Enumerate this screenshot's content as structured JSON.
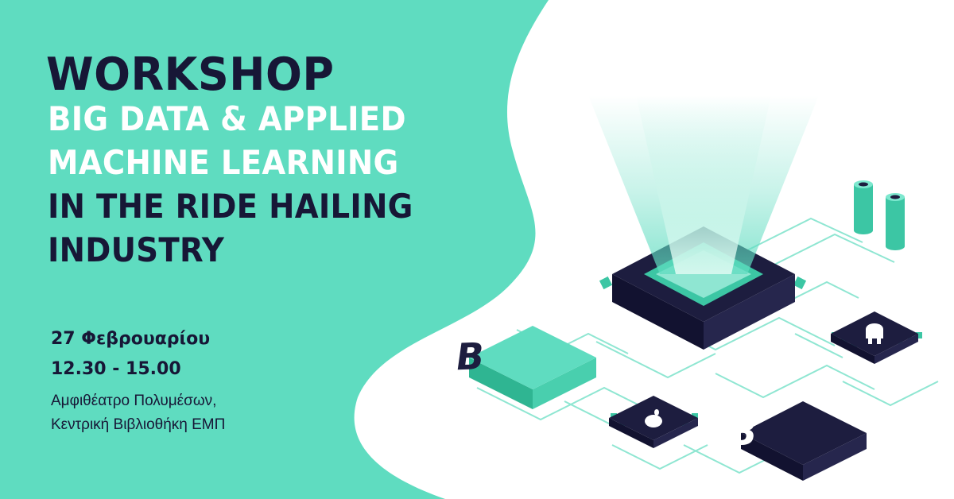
{
  "headline": {
    "title": "WORKSHOP",
    "lines": [
      "BIG DATA & APPLIED",
      "MACHINE LEARNING",
      "IN THE RIDE HAILING",
      "INDUSTRY"
    ]
  },
  "event": {
    "date": "27 Φεβρουαρίου",
    "time": "12.30 - 15.00",
    "venue_line1": "Αμφιθέατρο Πολυμέσων,",
    "venue_line2": "Κεντρική Βιβλιοθήκη ΕΜΠ"
  },
  "logo_letter": "B",
  "icons": [
    "beat-logo-icon",
    "android-icon",
    "apple-icon",
    "cpu-chip-icon",
    "sensor-cylinder-icon"
  ],
  "colors": {
    "mint": "#5fdcc0",
    "navy": "#1d1d3f",
    "white": "#ffffff"
  }
}
